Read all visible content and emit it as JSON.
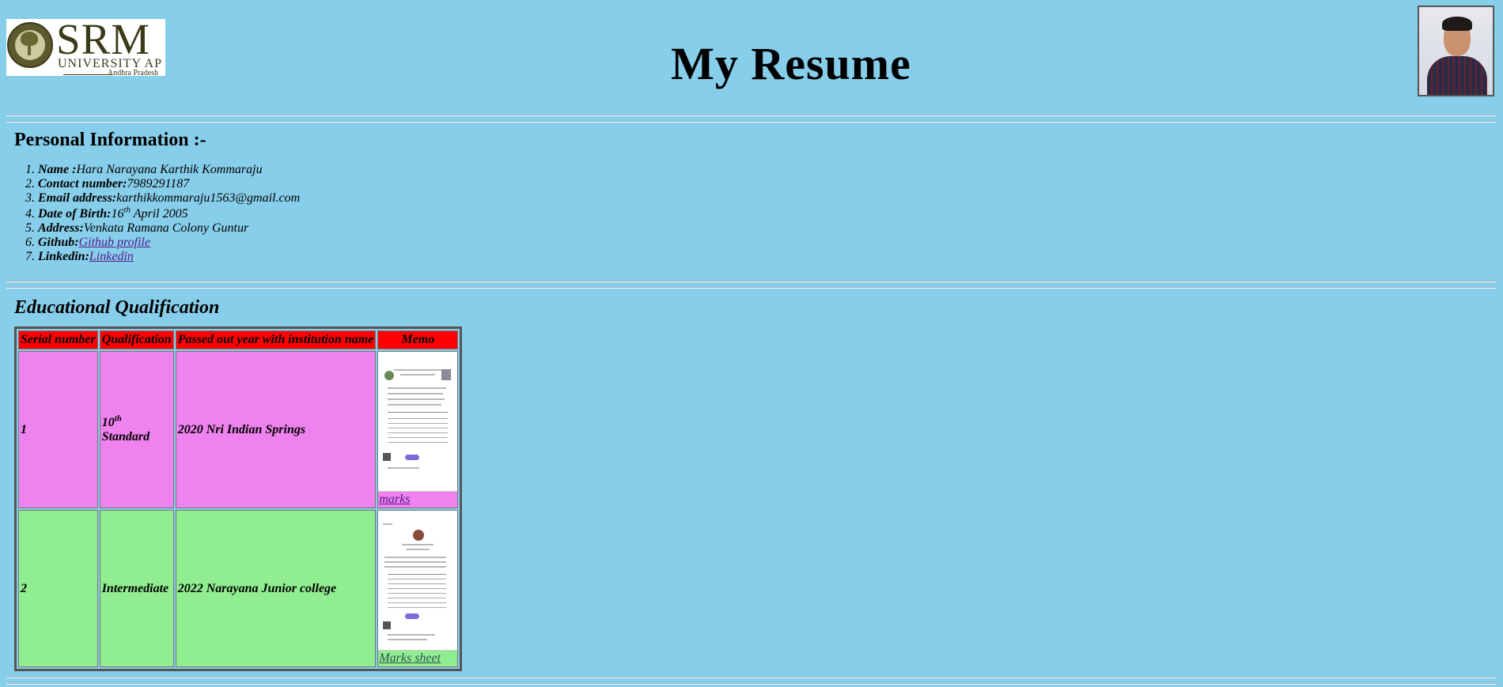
{
  "header": {
    "logo": {
      "brand": "SRM",
      "subtitle": "UNIVERSITY AP",
      "region": "Andhra Pradesh"
    },
    "title": "My Resume"
  },
  "personal": {
    "heading": "Personal Information :-",
    "items": [
      {
        "label": "Name :",
        "value": "Hara Narayana Karthik Kommaraju"
      },
      {
        "label": "Contact number:",
        "value": "7989291187"
      },
      {
        "label": "Email address:",
        "value": "karthikkommaraju1563@gmail.com"
      },
      {
        "label": "Date of Birth:",
        "value_prefix": "16",
        "value_sup": "th",
        "value_suffix": " April 2005"
      },
      {
        "label": "Address:",
        "value": "Venkata Ramana Colony Guntur"
      },
      {
        "label": "Github:",
        "link": "Github profile"
      },
      {
        "label": "Linkedin:",
        "link": "Linkedin"
      }
    ]
  },
  "education": {
    "heading": "Educational Qualification",
    "columns": [
      "Serial number",
      "Qualification",
      "Passed out year with institution name",
      "Memo"
    ],
    "rows": [
      {
        "serial": "1",
        "qual_prefix": "10",
        "qual_sup": "th",
        "qual_suffix": " Standard",
        "institution": "2020 Nri Indian Springs",
        "memo_link": "marks"
      },
      {
        "serial": "2",
        "qualification": "Intermediate",
        "institution": "2022 Narayana Junior college",
        "memo_link": "Marks sheet"
      }
    ]
  },
  "colors": {
    "background": "#87ceeb",
    "header_row": "#ff0000",
    "row1": "#ee82ee",
    "row2": "#90ee90"
  }
}
